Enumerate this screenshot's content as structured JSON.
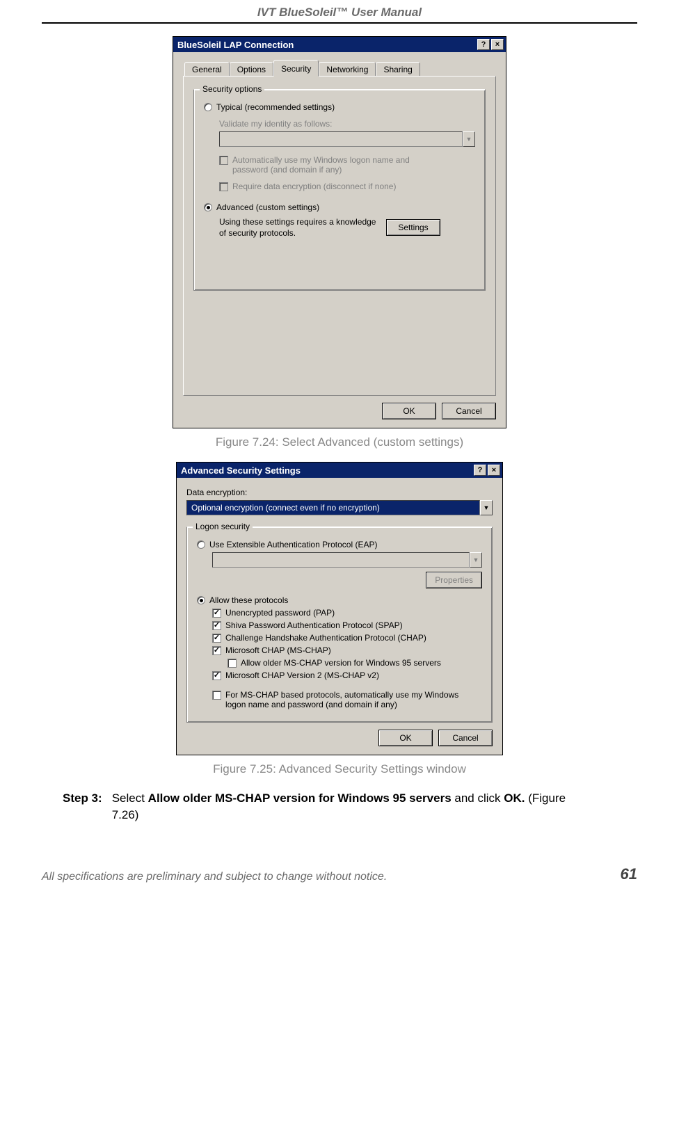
{
  "doc": {
    "header": "IVT BlueSoleil™ User Manual",
    "caption1": "Figure 7.24: Select Advanced (custom settings)",
    "caption2": "Figure 7.25: Advanced Security Settings window",
    "step_label": "Step 3:",
    "step_text_a": "Select ",
    "step_text_b": "Allow older MS-CHAP version for Windows 95 servers",
    "step_text_c": " and click ",
    "step_text_d": "OK.",
    "step_text_e": " (Figure 7.26)",
    "footer_note": "All specifications are preliminary and subject to change without notice.",
    "pagenum": "61"
  },
  "dlg1": {
    "title": "BlueSoleil LAP Connection",
    "help": "?",
    "close": "×",
    "tabs": [
      "General",
      "Options",
      "Security",
      "Networking",
      "Sharing"
    ],
    "group": "Security options",
    "typical": "Typical (recommended settings)",
    "validate": "Validate my identity as follows:",
    "auto_logon": "Automatically use my Windows logon name and password (and domain if any)",
    "require_enc": "Require data encryption (disconnect if none)",
    "advanced": "Advanced (custom settings)",
    "adv_note": "Using these settings requires a knowledge of security protocols.",
    "settings_btn": "Settings",
    "ok": "OK",
    "cancel": "Cancel"
  },
  "dlg2": {
    "title": "Advanced Security Settings",
    "help": "?",
    "close": "×",
    "enc_label": "Data encryption:",
    "enc_value": "Optional encryption (connect even if no encryption)",
    "group": "Logon security",
    "eap": "Use Extensible Authentication Protocol (EAP)",
    "properties": "Properties",
    "allow": "Allow these protocols",
    "pap": "Unencrypted password (PAP)",
    "spap": "Shiva Password Authentication Protocol (SPAP)",
    "chap": "Challenge Handshake Authentication Protocol (CHAP)",
    "mschap": "Microsoft CHAP (MS-CHAP)",
    "mschap95": "Allow older MS-CHAP version for Windows 95 servers",
    "mschap2": "Microsoft CHAP Version 2 (MS-CHAP v2)",
    "autologon": "For MS-CHAP based protocols, automatically use my Windows logon name and password (and domain if any)",
    "ok": "OK",
    "cancel": "Cancel"
  }
}
